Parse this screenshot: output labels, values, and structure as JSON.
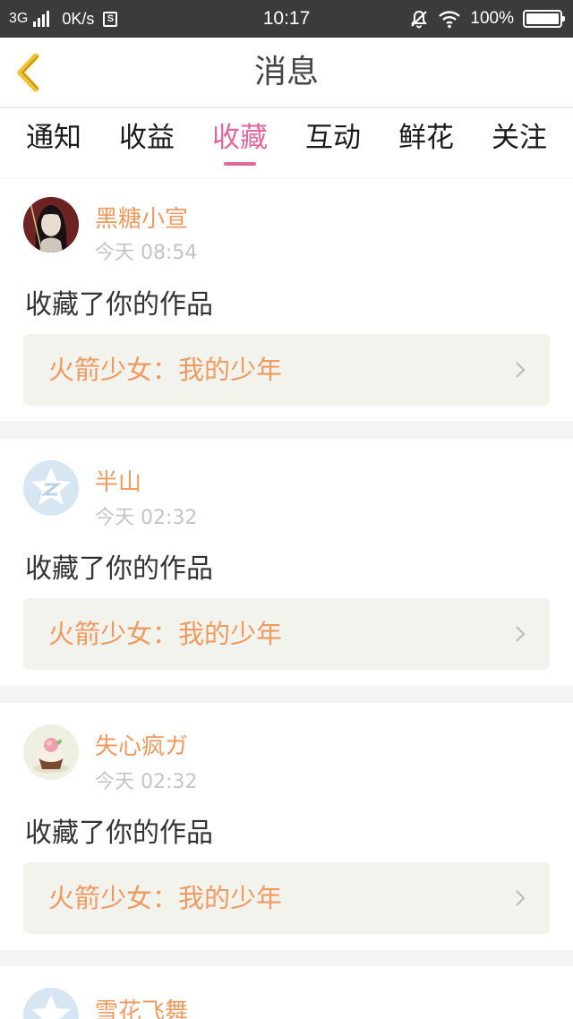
{
  "status_bar": {
    "network": "3G",
    "speed": "0K/s",
    "s_badge": "S",
    "time": "10:17",
    "battery": "100%",
    "battery_level_percent": 100
  },
  "header": {
    "title": "消息",
    "back_icon": "chevron-left-icon"
  },
  "tabs": [
    {
      "label": "通知",
      "active": false
    },
    {
      "label": "收益",
      "active": false
    },
    {
      "label": "收藏",
      "active": true
    },
    {
      "label": "互动",
      "active": false
    },
    {
      "label": "鲜花",
      "active": false
    },
    {
      "label": "关注",
      "active": false
    }
  ],
  "messages": [
    {
      "user": "黑糖小宣",
      "time": "今天 08:54",
      "action": "收藏了你的作品",
      "work": "火箭少女：我的少年",
      "avatar_icon": "portrait-avatar-icon"
    },
    {
      "user": "半山",
      "time": "今天 02:32",
      "action": "收藏了你的作品",
      "work": "火箭少女：我的少年",
      "avatar_icon": "default-star-avatar-icon"
    },
    {
      "user": "失心疯ガ",
      "time": "今天 02:32",
      "action": "收藏了你的作品",
      "work": "火箭少女：我的少年",
      "avatar_icon": "cupcake-avatar-icon"
    },
    {
      "user": "雪花飞舞",
      "avatar_icon": "default-star-avatar-icon"
    }
  ],
  "colors": {
    "accent_pink": "#e0679c",
    "name_orange": "#ef9a60",
    "back_yellow": "#f2c230",
    "status_bar": "#3b3b3b"
  }
}
